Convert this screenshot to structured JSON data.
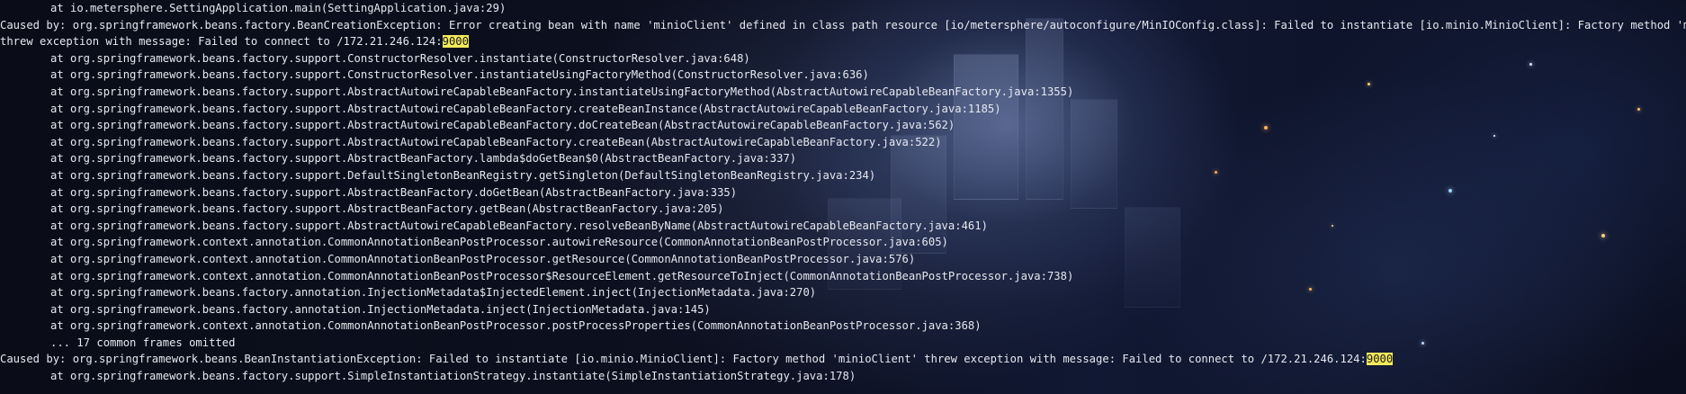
{
  "terminal": {
    "background_accent": "#f3e95a",
    "lines": [
      {
        "indent": true,
        "text": "at io.metersphere.SettingApplication.main(SettingApplication.java:29)",
        "highlight": ""
      },
      {
        "indent": false,
        "text": "Caused by: org.springframework.beans.factory.BeanCreationException: Error creating bean with name 'minioClient' defined in class path resource [io/metersphere/autoconfigure/MinIOConfig.class]: Failed to instantiate [io.minio.MinioClient]: Factory method 'minioClient'",
        "highlight": ""
      },
      {
        "indent": false,
        "text": "threw exception with message: Failed to connect to /172.21.246.124:",
        "highlight": "9000"
      },
      {
        "indent": true,
        "text": "at org.springframework.beans.factory.support.ConstructorResolver.instantiate(ConstructorResolver.java:648)",
        "highlight": ""
      },
      {
        "indent": true,
        "text": "at org.springframework.beans.factory.support.ConstructorResolver.instantiateUsingFactoryMethod(ConstructorResolver.java:636)",
        "highlight": ""
      },
      {
        "indent": true,
        "text": "at org.springframework.beans.factory.support.AbstractAutowireCapableBeanFactory.instantiateUsingFactoryMethod(AbstractAutowireCapableBeanFactory.java:1355)",
        "highlight": ""
      },
      {
        "indent": true,
        "text": "at org.springframework.beans.factory.support.AbstractAutowireCapableBeanFactory.createBeanInstance(AbstractAutowireCapableBeanFactory.java:1185)",
        "highlight": ""
      },
      {
        "indent": true,
        "text": "at org.springframework.beans.factory.support.AbstractAutowireCapableBeanFactory.doCreateBean(AbstractAutowireCapableBeanFactory.java:562)",
        "highlight": ""
      },
      {
        "indent": true,
        "text": "at org.springframework.beans.factory.support.AbstractAutowireCapableBeanFactory.createBean(AbstractAutowireCapableBeanFactory.java:522)",
        "highlight": ""
      },
      {
        "indent": true,
        "text": "at org.springframework.beans.factory.support.AbstractBeanFactory.lambda$doGetBean$0(AbstractBeanFactory.java:337)",
        "highlight": ""
      },
      {
        "indent": true,
        "text": "at org.springframework.beans.factory.support.DefaultSingletonBeanRegistry.getSingleton(DefaultSingletonBeanRegistry.java:234)",
        "highlight": ""
      },
      {
        "indent": true,
        "text": "at org.springframework.beans.factory.support.AbstractBeanFactory.doGetBean(AbstractBeanFactory.java:335)",
        "highlight": ""
      },
      {
        "indent": true,
        "text": "at org.springframework.beans.factory.support.AbstractBeanFactory.getBean(AbstractBeanFactory.java:205)",
        "highlight": ""
      },
      {
        "indent": true,
        "text": "at org.springframework.beans.factory.support.AbstractAutowireCapableBeanFactory.resolveBeanByName(AbstractAutowireCapableBeanFactory.java:461)",
        "highlight": ""
      },
      {
        "indent": true,
        "text": "at org.springframework.context.annotation.CommonAnnotationBeanPostProcessor.autowireResource(CommonAnnotationBeanPostProcessor.java:605)",
        "highlight": ""
      },
      {
        "indent": true,
        "text": "at org.springframework.context.annotation.CommonAnnotationBeanPostProcessor.getResource(CommonAnnotationBeanPostProcessor.java:576)",
        "highlight": ""
      },
      {
        "indent": true,
        "text": "at org.springframework.context.annotation.CommonAnnotationBeanPostProcessor$ResourceElement.getResourceToInject(CommonAnnotationBeanPostProcessor.java:738)",
        "highlight": ""
      },
      {
        "indent": true,
        "text": "at org.springframework.beans.factory.annotation.InjectionMetadata$InjectedElement.inject(InjectionMetadata.java:270)",
        "highlight": ""
      },
      {
        "indent": true,
        "text": "at org.springframework.beans.factory.annotation.InjectionMetadata.inject(InjectionMetadata.java:145)",
        "highlight": ""
      },
      {
        "indent": true,
        "text": "at org.springframework.context.annotation.CommonAnnotationBeanPostProcessor.postProcessProperties(CommonAnnotationBeanPostProcessor.java:368)",
        "highlight": ""
      },
      {
        "indent": true,
        "text": "... 17 common frames omitted",
        "highlight": ""
      },
      {
        "indent": false,
        "text": "Caused by: org.springframework.beans.BeanInstantiationException: Failed to instantiate [io.minio.MinioClient]: Factory method 'minioClient' threw exception with message: Failed to connect to /172.21.246.124:",
        "highlight": "9000"
      },
      {
        "indent": true,
        "text": "at org.springframework.beans.factory.support.SimpleInstantiationStrategy.instantiate(SimpleInstantiationStrategy.java:178)",
        "highlight": ""
      }
    ]
  }
}
